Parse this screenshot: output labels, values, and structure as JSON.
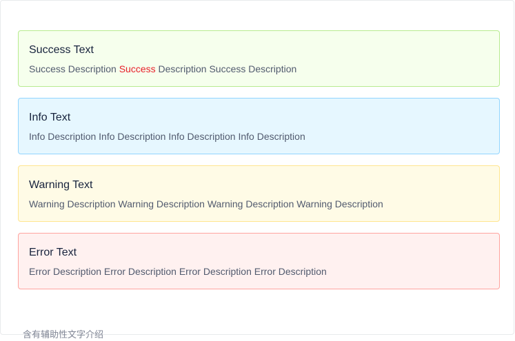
{
  "alerts": {
    "success": {
      "title": "Success Text",
      "desc_before": "Success Description ",
      "desc_highlight": "Success",
      "desc_after": " Description Success Description"
    },
    "info": {
      "title": "Info Text",
      "desc": "Info Description Info Description Info Description Info Description"
    },
    "warning": {
      "title": "Warning Text",
      "desc": "Warning Description Warning Description Warning Description Warning Description"
    },
    "error": {
      "title": "Error Text",
      "desc": "Error Description Error Description Error Description Error Description"
    }
  },
  "footer_note": "含有辅助性文字介绍",
  "colors": {
    "success_bg": "#f6ffed",
    "success_border": "#b7eb8f",
    "info_bg": "#e6f7ff",
    "info_border": "#91d5ff",
    "warning_bg": "#fffbe6",
    "warning_border": "#ffe58f",
    "error_bg": "#fff1f0",
    "error_border": "#ffa39e",
    "highlight": "#e8202a"
  }
}
